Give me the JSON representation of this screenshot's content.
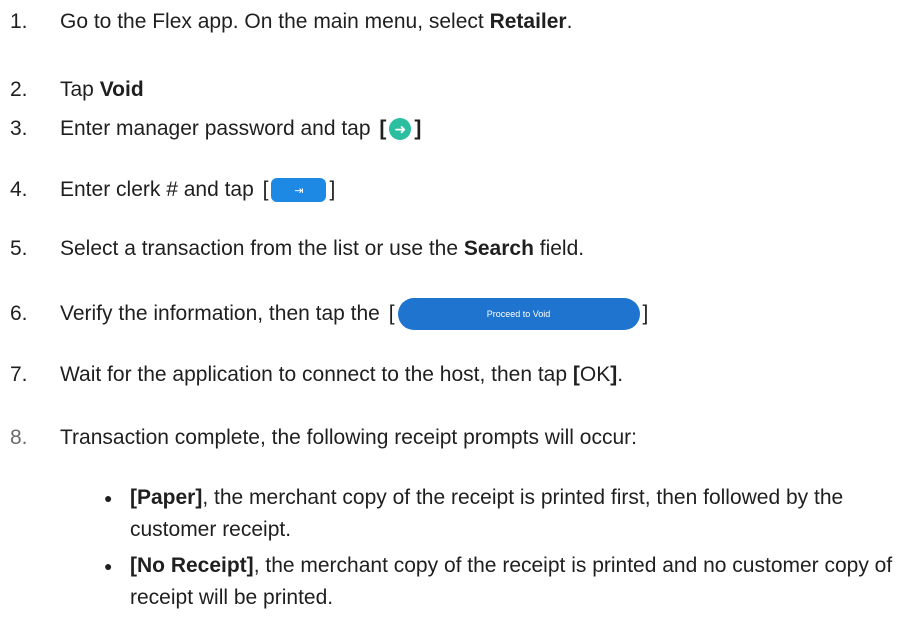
{
  "steps": [
    {
      "num": "1.",
      "pre": "Go to the Flex app. On the main menu, select ",
      "bold": "Retailer",
      "post": "."
    },
    {
      "num": "2.",
      "pre": "Tap ",
      "bold": "Void"
    },
    {
      "num": "3.",
      "pre": "Enter manager password and tap ",
      "open": "[",
      "close": "]"
    },
    {
      "num": "4.",
      "pre": "Enter clerk # and tap ",
      "open": "[",
      "close": "]"
    },
    {
      "num": "5.",
      "pre": "Select a transaction from the list or use the ",
      "bold": "Search",
      "post": " field."
    },
    {
      "num": "6.",
      "pre": "Verify the information, then tap the ",
      "open": "[",
      "close": "]",
      "button_label": "Proceed to Void"
    },
    {
      "num": "7.",
      "pre": "Wait for the application to connect to the host, then tap ",
      "open": "[",
      "mid": "OK",
      "close": "]",
      "post": "."
    },
    {
      "num": "8.",
      "pre": "Transaction complete, the following receipt prompts will occur:"
    }
  ],
  "bullets": [
    {
      "dot": "●",
      "bold": "[Paper]",
      "text": ", the merchant copy of the receipt is printed first, then followed by the customer receipt."
    },
    {
      "dot": "●",
      "bold": "[No Receipt]",
      "text": ", the merchant copy of the receipt is printed and no customer copy of receipt will be printed."
    }
  ],
  "icons": {
    "step3": "arrow-right-circle-icon",
    "step4": "enter-arrow-icon"
  },
  "colors": {
    "circle_button": "#2bbfa0",
    "enter_button": "#1e88e5",
    "proceed_button": "#1e74cf"
  }
}
